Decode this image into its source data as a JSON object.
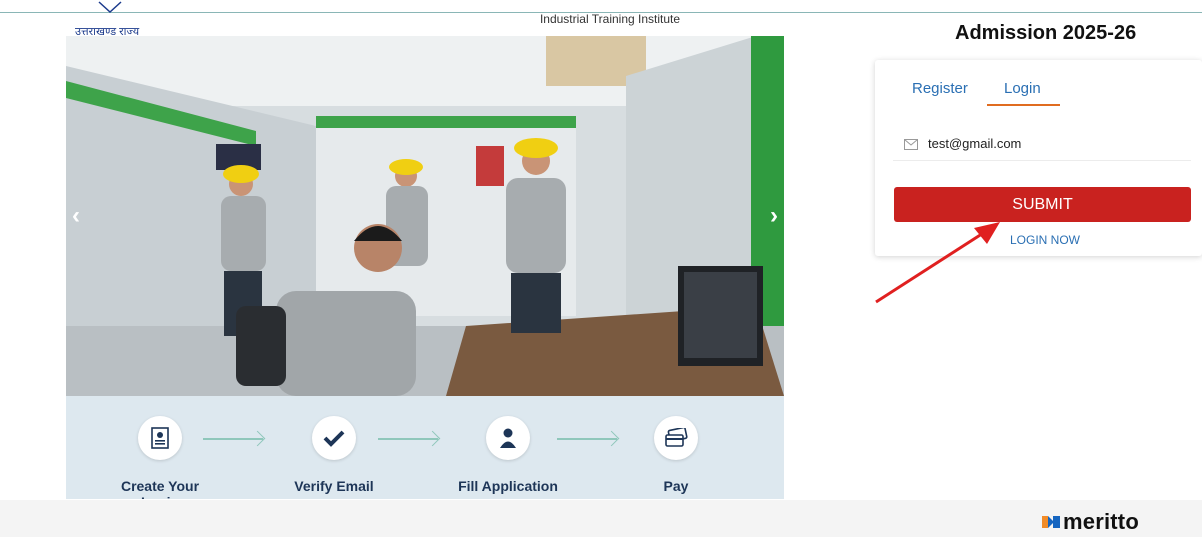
{
  "header": {
    "state_name": "उत्तराखण्ड राज्य",
    "institute": "Industrial Training Institute"
  },
  "hero": {
    "prev_icon": "chevron-left-icon",
    "next_icon": "chevron-right-icon",
    "prev_glyph": "‹",
    "next_glyph": "›"
  },
  "steps": [
    {
      "label": "Create Your Login",
      "icon": "id-card-icon"
    },
    {
      "label": "Verify Email",
      "icon": "checkmark-icon"
    },
    {
      "label": "Fill Application",
      "icon": "person-icon"
    },
    {
      "label": "Pay",
      "icon": "credit-card-icon"
    }
  ],
  "form": {
    "title": "Admission 2025-26",
    "tabs": [
      {
        "label": "Register",
        "active": false
      },
      {
        "label": "Login",
        "active": true
      }
    ],
    "email_value": "test@gmail.com",
    "submit_label": "SUBMIT",
    "login_now_label": "LOGIN NOW"
  },
  "footer": {
    "brand": "meritto"
  },
  "colors": {
    "accent_blue": "#2a6fb3",
    "submit_red": "#c9221f",
    "tab_orange": "#e06c20",
    "annotation_arrow": "#e02020"
  }
}
